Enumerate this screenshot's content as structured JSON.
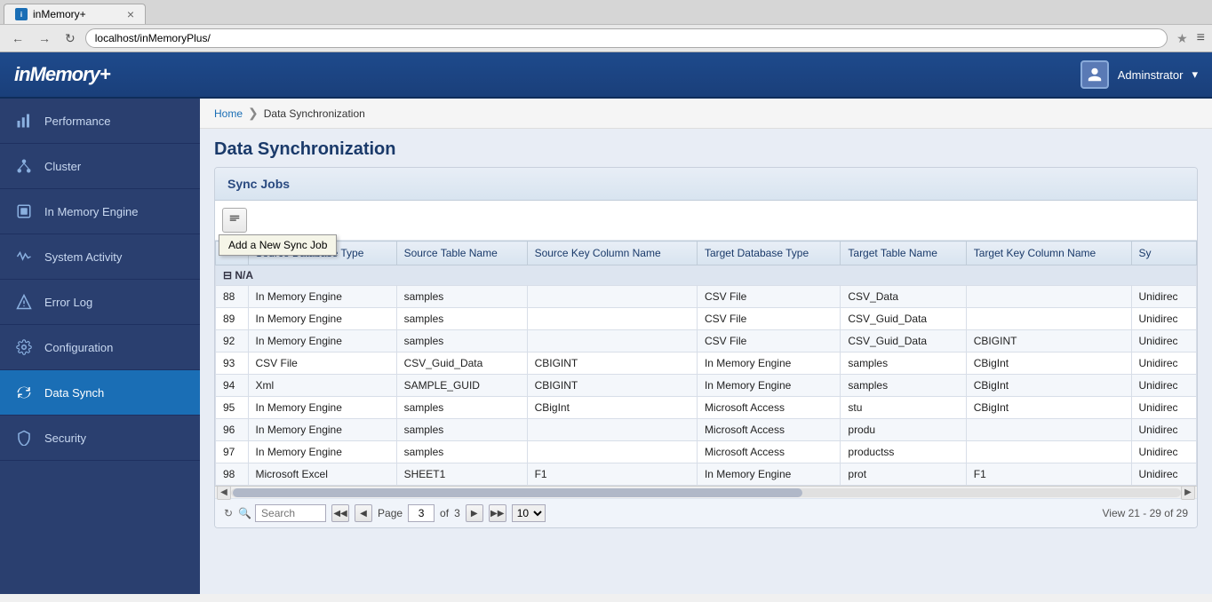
{
  "browser": {
    "tab_label": "inMemory+",
    "url": "localhost/inMemoryPlus/",
    "close_symbol": "×"
  },
  "app": {
    "logo": "inMemory+",
    "user": "Adminstrator",
    "dropdown_symbol": "▾"
  },
  "sidebar": {
    "items": [
      {
        "id": "performance",
        "label": "Performance",
        "icon": "chart"
      },
      {
        "id": "cluster",
        "label": "Cluster",
        "icon": "cluster"
      },
      {
        "id": "in-memory-engine",
        "label": "In Memory Engine",
        "icon": "engine"
      },
      {
        "id": "system-activity",
        "label": "System Activity",
        "icon": "activity"
      },
      {
        "id": "error-log",
        "label": "Error Log",
        "icon": "warning"
      },
      {
        "id": "configuration",
        "label": "Configuration",
        "icon": "config"
      },
      {
        "id": "data-synch",
        "label": "Data Synch",
        "icon": "sync",
        "active": true
      },
      {
        "id": "security",
        "label": "Security",
        "icon": "security"
      }
    ]
  },
  "breadcrumb": {
    "home": "Home",
    "separator": "❯",
    "current": "Data Synchronization"
  },
  "page": {
    "title": "Data Synchronization",
    "panel_title": "Sync Jobs",
    "add_tooltip": "Add a New Sync Job"
  },
  "table": {
    "columns": [
      "",
      "Source Database Type",
      "Source Table Name",
      "Source Key Column Name",
      "Target Database Type",
      "Target Table Name",
      "Target Key Column Name",
      "Sy"
    ],
    "group_header": "N/A",
    "rows": [
      {
        "id": "88",
        "src_db": "In Memory Engine",
        "src_table": "samples",
        "src_key": "",
        "tgt_db": "CSV File",
        "tgt_table": "CSV_Data",
        "tgt_key": "",
        "sync": "Unidirec"
      },
      {
        "id": "89",
        "src_db": "In Memory Engine",
        "src_table": "samples",
        "src_key": "",
        "tgt_db": "CSV File",
        "tgt_table": "CSV_Guid_Data",
        "tgt_key": "",
        "sync": "Unidirec"
      },
      {
        "id": "92",
        "src_db": "In Memory Engine",
        "src_table": "samples",
        "src_key": "",
        "tgt_db": "CSV File",
        "tgt_table": "CSV_Guid_Data",
        "tgt_key": "CBIGINT",
        "sync": "Unidirec"
      },
      {
        "id": "93",
        "src_db": "CSV File",
        "src_table": "CSV_Guid_Data",
        "src_key": "CBIGINT",
        "tgt_db": "In Memory Engine",
        "tgt_table": "samples",
        "tgt_key": "CBigInt",
        "sync": "Unidirec"
      },
      {
        "id": "94",
        "src_db": "Xml",
        "src_table": "SAMPLE_GUID",
        "src_key": "CBIGINT",
        "tgt_db": "In Memory Engine",
        "tgt_table": "samples",
        "tgt_key": "CBigInt",
        "sync": "Unidirec"
      },
      {
        "id": "95",
        "src_db": "In Memory Engine",
        "src_table": "samples",
        "src_key": "CBigInt",
        "tgt_db": "Microsoft Access",
        "tgt_table": "stu",
        "tgt_key": "CBigInt",
        "sync": "Unidirec"
      },
      {
        "id": "96",
        "src_db": "In Memory Engine",
        "src_table": "samples",
        "src_key": "",
        "tgt_db": "Microsoft Access",
        "tgt_table": "produ",
        "tgt_key": "",
        "sync": "Unidirec"
      },
      {
        "id": "97",
        "src_db": "In Memory Engine",
        "src_table": "samples",
        "src_key": "",
        "tgt_db": "Microsoft Access",
        "tgt_table": "productss",
        "tgt_key": "",
        "sync": "Unidirec"
      },
      {
        "id": "98",
        "src_db": "Microsoft Excel",
        "src_table": "SHEET1",
        "src_key": "F1",
        "tgt_db": "In Memory Engine",
        "tgt_table": "prot",
        "tgt_key": "F1",
        "sync": "Unidirec"
      }
    ]
  },
  "pagination": {
    "search_placeholder": "Search",
    "first_label": "◀◀",
    "prev_label": "◀",
    "next_label": "▶",
    "last_label": "▶▶",
    "page_label": "Page",
    "current_page": "3",
    "of_label": "of",
    "total_pages": "3",
    "page_size": "10",
    "view_range": "View 21 - 29 of 29"
  }
}
